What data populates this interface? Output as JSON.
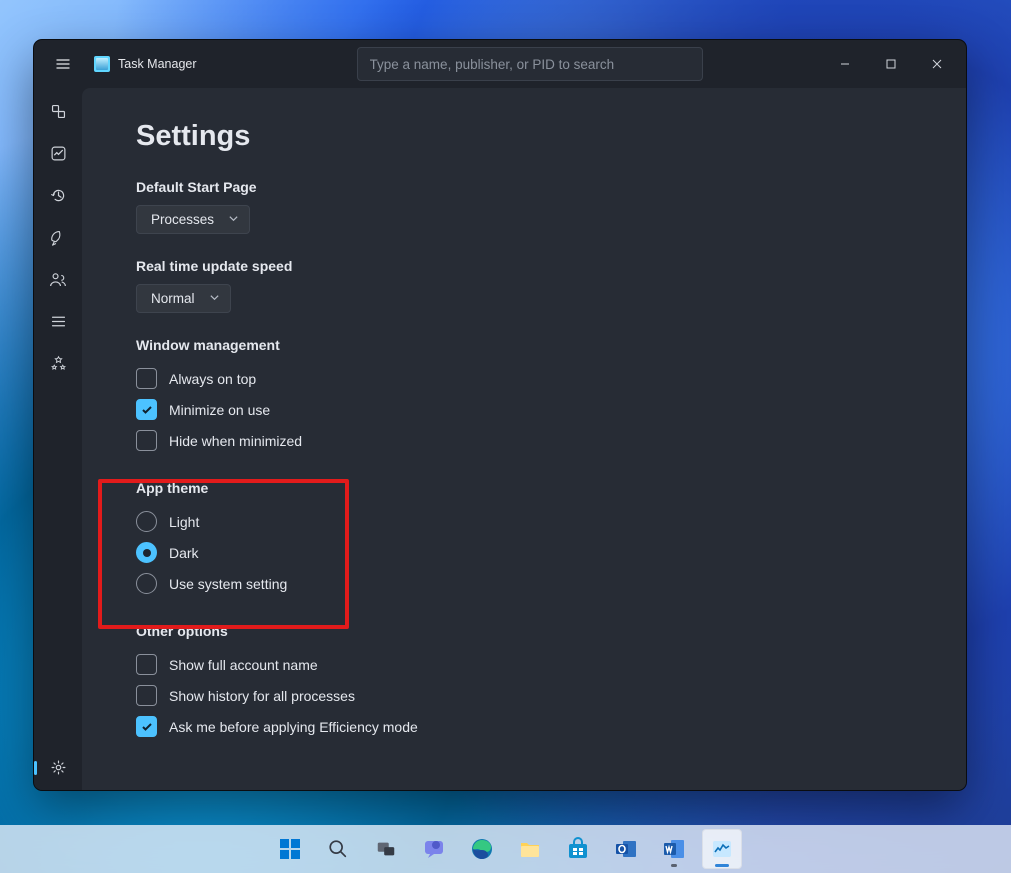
{
  "app": {
    "title": "Task Manager"
  },
  "search": {
    "placeholder": "Type a name, publisher, or PID to search"
  },
  "page": {
    "title": "Settings"
  },
  "sections": {
    "default_start": {
      "label": "Default Start Page",
      "value": "Processes"
    },
    "update_speed": {
      "label": "Real time update speed",
      "value": "Normal"
    },
    "window_mgmt": {
      "label": "Window management",
      "always_on_top": "Always on top",
      "minimize_on_use": "Minimize on use",
      "hide_when_min": "Hide when minimized"
    },
    "app_theme": {
      "label": "App theme",
      "light": "Light",
      "dark": "Dark",
      "system": "Use system setting"
    },
    "other": {
      "label": "Other options",
      "full_account": "Show full account name",
      "history_all": "Show history for all processes",
      "ask_efficiency": "Ask me before applying Efficiency mode"
    }
  },
  "sidebar": {
    "items": [
      "processes",
      "performance",
      "app-history",
      "startup-apps",
      "users",
      "details",
      "services"
    ],
    "settings": "settings"
  },
  "taskbar": {
    "items": [
      "start",
      "search",
      "task-view",
      "chat",
      "edge",
      "file-explorer",
      "microsoft-store",
      "outlook",
      "word",
      "task-manager"
    ]
  }
}
